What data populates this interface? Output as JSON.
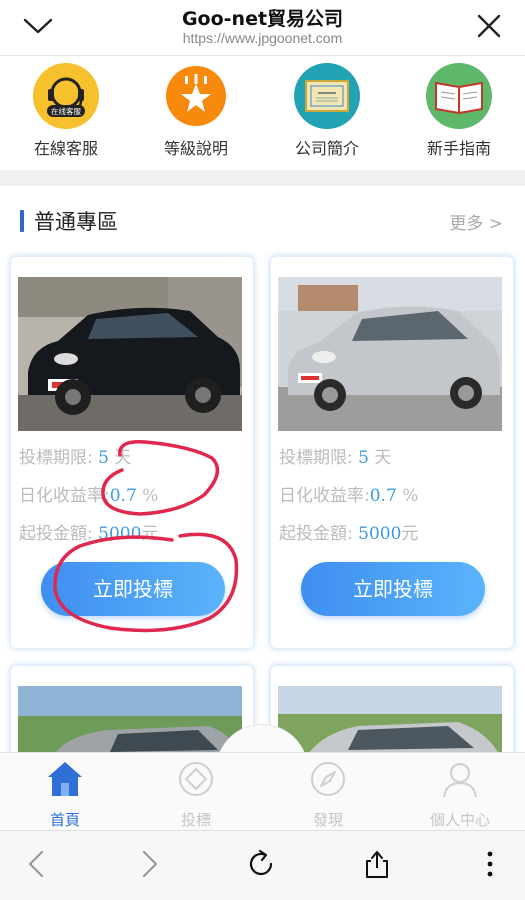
{
  "header": {
    "title": "Goo-net貿易公司",
    "url": "https://www.jpgoonet.com"
  },
  "quick_links": [
    {
      "label": "在線客服",
      "badge": "在线客服",
      "icon": "headset-icon",
      "color": "#f6c12c"
    },
    {
      "label": "等級說明",
      "icon": "star-badge-icon",
      "color": "#f7890c"
    },
    {
      "label": "公司簡介",
      "icon": "certificate-icon",
      "color": "#22a3b4"
    },
    {
      "label": "新手指南",
      "icon": "book-icon",
      "color": "#5fb86a"
    }
  ],
  "section": {
    "title": "普通專區",
    "more": "更多 >"
  },
  "products": [
    {
      "term_label": "投標期限:",
      "term_value": "5",
      "term_unit": "天",
      "rate_label": "日化收益率:",
      "rate_value": "0.7",
      "rate_unit": "%",
      "min_label": "起投金額:",
      "min_value": "5000",
      "min_unit": "元",
      "button": "立即投標"
    },
    {
      "term_label": "投標期限:",
      "term_value": "5",
      "term_unit": "天",
      "rate_label": "日化收益率:",
      "rate_value": "0.7",
      "rate_unit": "%",
      "min_label": "起投金額:",
      "min_value": "5000",
      "min_unit": "元",
      "button": "立即投標"
    }
  ],
  "tabs": [
    {
      "label": "首頁",
      "icon": "home-icon",
      "active": true
    },
    {
      "label": "投標",
      "icon": "bid-icon",
      "active": false
    },
    {
      "label": "發現",
      "icon": "compass-icon",
      "active": false
    },
    {
      "label": "個人中心",
      "icon": "user-icon",
      "active": false
    }
  ],
  "colors": {
    "accent": "#2f6fd6",
    "button_start": "#3f8ef0",
    "button_end": "#5ab4fb",
    "value_blue": "#3b9be0",
    "annotation_red": "#e0284f"
  }
}
